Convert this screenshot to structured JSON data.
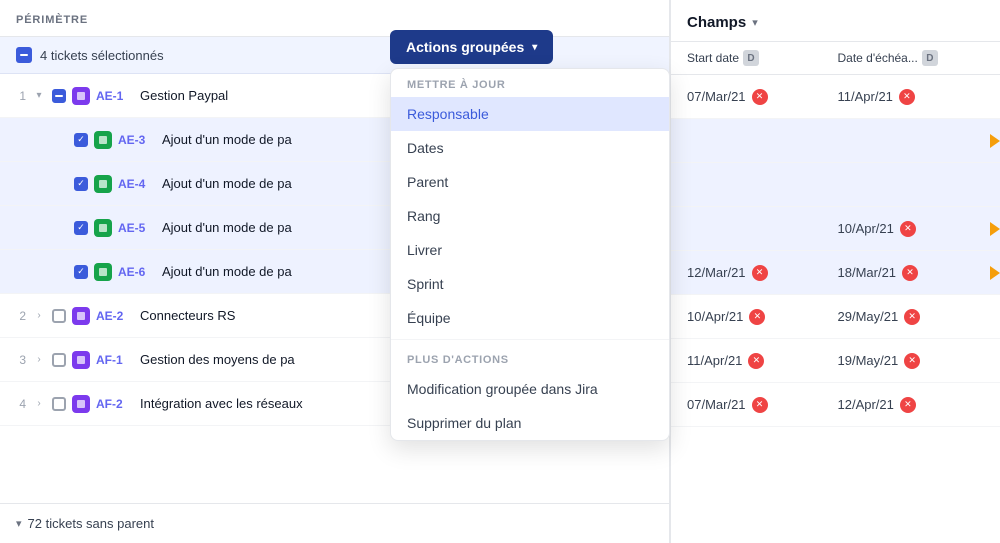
{
  "header": {
    "perimetre_label": "PÉRIMÈTRE",
    "selected_count": "4 tickets sélectionnés",
    "champs_title": "Champs",
    "champs_chevron": "▾"
  },
  "actions_button": {
    "label": "Actions groupées",
    "chevron": "▾"
  },
  "dropdown": {
    "section1_label": "METTRE À JOUR",
    "items1": [
      {
        "id": "responsable",
        "label": "Responsable",
        "active": true
      },
      {
        "id": "dates",
        "label": "Dates",
        "active": false
      },
      {
        "id": "parent",
        "label": "Parent",
        "active": false
      },
      {
        "id": "rang",
        "label": "Rang",
        "active": false
      },
      {
        "id": "livrer",
        "label": "Livrer",
        "active": false
      },
      {
        "id": "sprint",
        "label": "Sprint",
        "active": false
      },
      {
        "id": "equipe",
        "label": "Équipe",
        "active": false
      }
    ],
    "section2_label": "PLUS D'ACTIONS",
    "items2": [
      {
        "id": "modif-jira",
        "label": "Modification groupée dans Jira"
      },
      {
        "id": "suppr-plan",
        "label": "Supprimer du plan"
      }
    ]
  },
  "col_headers": {
    "start_date": "Start date",
    "start_d": "D",
    "due_date": "Date d'échéa...",
    "due_d": "D"
  },
  "tickets": [
    {
      "row_num": "1",
      "level": 1,
      "has_chevron": true,
      "chevron": "▾",
      "checkbox": "minus",
      "badge_color": "purple",
      "badge_letter": "★",
      "ticket_id": "AE-1",
      "title": "Gestion Paypal",
      "highlighted": false,
      "start_date": "07/Mar/21",
      "due_date": "11/Apr/21",
      "has_start_clear": true,
      "has_due_clear": true,
      "has_orange_arrow": false
    },
    {
      "row_num": "",
      "level": 2,
      "has_chevron": false,
      "chevron": "",
      "checkbox": "checked",
      "badge_color": "green",
      "badge_letter": "■",
      "ticket_id": "AE-3",
      "title": "Ajout d'un mode de pa",
      "highlighted": true,
      "start_date": "",
      "due_date": "",
      "has_start_clear": false,
      "has_due_clear": false,
      "has_orange_arrow": true
    },
    {
      "row_num": "",
      "level": 2,
      "has_chevron": false,
      "chevron": "",
      "checkbox": "checked",
      "badge_color": "green",
      "badge_letter": "■",
      "ticket_id": "AE-4",
      "title": "Ajout d'un mode de pa",
      "highlighted": true,
      "start_date": "",
      "due_date": "",
      "has_start_clear": false,
      "has_due_clear": false,
      "has_orange_arrow": false
    },
    {
      "row_num": "",
      "level": 2,
      "has_chevron": false,
      "chevron": "",
      "checkbox": "checked",
      "badge_color": "green",
      "badge_letter": "■",
      "ticket_id": "AE-5",
      "title": "Ajout d'un mode de pa",
      "highlighted": true,
      "start_date": "",
      "due_date": "10/Apr/21",
      "has_start_clear": false,
      "has_due_clear": true,
      "has_orange_arrow": true
    },
    {
      "row_num": "",
      "level": 2,
      "has_chevron": false,
      "chevron": "",
      "checkbox": "checked",
      "badge_color": "green",
      "badge_letter": "■",
      "ticket_id": "AE-6",
      "title": "Ajout d'un mode de pa",
      "highlighted": true,
      "start_date": "12/Mar/21",
      "due_date": "18/Mar/21",
      "has_start_clear": true,
      "has_due_clear": true,
      "has_orange_arrow": true
    },
    {
      "row_num": "2",
      "level": 1,
      "has_chevron": true,
      "chevron": "›",
      "checkbox": "empty",
      "badge_color": "purple",
      "badge_letter": "★",
      "ticket_id": "AE-2",
      "title": "Connecteurs RS",
      "highlighted": false,
      "start_date": "10/Apr/21",
      "due_date": "29/May/21",
      "has_start_clear": true,
      "has_due_clear": true,
      "has_orange_arrow": false
    },
    {
      "row_num": "3",
      "level": 1,
      "has_chevron": true,
      "chevron": "›",
      "checkbox": "empty",
      "badge_color": "purple",
      "badge_letter": "★",
      "ticket_id": "AF-1",
      "title": "Gestion des moyens de pa",
      "highlighted": false,
      "start_date": "11/Apr/21",
      "due_date": "19/May/21",
      "has_start_clear": true,
      "has_due_clear": true,
      "has_orange_arrow": false
    },
    {
      "row_num": "4",
      "level": 1,
      "has_chevron": true,
      "chevron": "›",
      "checkbox": "empty",
      "badge_color": "purple",
      "badge_letter": "★",
      "ticket_id": "AF-2",
      "title": "Intégration avec les réseaux",
      "highlighted": false,
      "start_date": "07/Mar/21",
      "due_date": "12/Apr/21",
      "has_start_clear": true,
      "has_due_clear": true,
      "has_orange_arrow": false
    }
  ],
  "bottom": {
    "chevron": "▾",
    "text": "72 tickets sans parent"
  }
}
